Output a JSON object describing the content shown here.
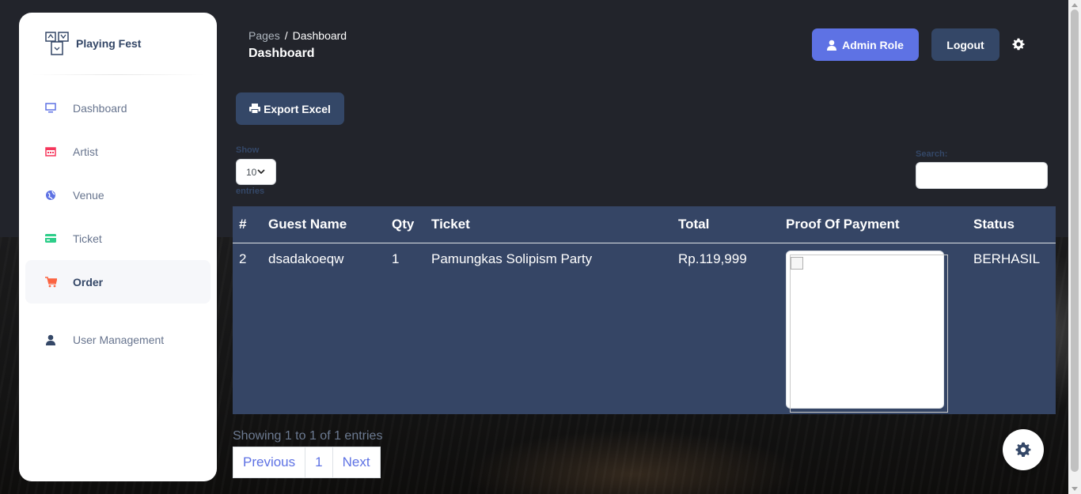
{
  "colors": {
    "primary": "#5e72e4",
    "dark": "#344767",
    "table_bg": "#354565",
    "page_bg": "#22242b"
  },
  "sidebar": {
    "brand": "Playing Fest",
    "items": [
      {
        "label": "Dashboard",
        "icon": "monitor-icon",
        "color": "#5e72e4"
      },
      {
        "label": "Artist",
        "icon": "calendar-icon",
        "color": "#f5365c"
      },
      {
        "label": "Venue",
        "icon": "globe-icon",
        "color": "#5e72e4"
      },
      {
        "label": "Ticket",
        "icon": "credit-card-icon",
        "color": "#2dce89"
      },
      {
        "label": "Order",
        "icon": "cart-icon",
        "color": "#fb6340",
        "active": true
      },
      {
        "label": "User Management",
        "icon": "user-icon",
        "color": "#344767"
      }
    ]
  },
  "header": {
    "breadcrumb": {
      "parent": "Pages",
      "separator": "/",
      "current": "Dashboard"
    },
    "title": "Dashboard",
    "admin_button": "Admin Role",
    "logout_button": "Logout"
  },
  "toolbar": {
    "export_label": "Export Excel"
  },
  "table_controls": {
    "show_label": "Show",
    "length_value": "10",
    "entries_label": "entries",
    "search_label": "Search:",
    "search_value": ""
  },
  "table": {
    "columns": [
      "#",
      "Guest Name",
      "Qty",
      "Ticket",
      "Total",
      "Proof Of Payment",
      "Status"
    ],
    "rows": [
      {
        "no": "2",
        "guest": "dsadakoeqw",
        "qty": "1",
        "ticket": "Pamungkas Solipism Party",
        "total": "Rp.119,999",
        "status": "BERHASIL"
      }
    ]
  },
  "footer": {
    "info": "Showing 1 to 1 of 1 entries",
    "pagination": {
      "previous": "Previous",
      "page": "1",
      "next": "Next"
    }
  }
}
